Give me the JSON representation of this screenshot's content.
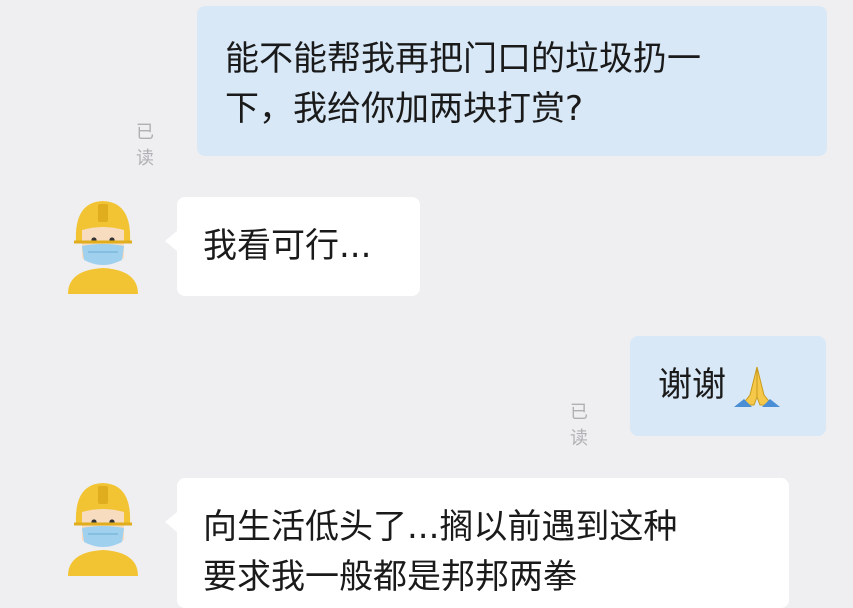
{
  "messages": [
    {
      "direction": "out",
      "lines": [
        "能不能帮我再把门口的垃圾扔一",
        "下，我给你加两块打赏?"
      ],
      "read_status": "已读"
    },
    {
      "direction": "in",
      "lines": [
        "我看可行..."
      ]
    },
    {
      "direction": "out",
      "lines": [
        "谢谢"
      ],
      "emoji": "folded-hands-icon",
      "read_status": "已读"
    },
    {
      "direction": "in",
      "lines": [
        "向生活低头了...搁以前遇到这种",
        "要求我一般都是邦邦两拳"
      ]
    }
  ],
  "colors": {
    "background": "#efeff1",
    "outgoing_bubble": "#d8e8f7",
    "incoming_bubble": "#ffffff",
    "read_text": "#b0b0b4",
    "avatar_helmet": "#f2c433",
    "avatar_mask": "#9fd0ee"
  }
}
